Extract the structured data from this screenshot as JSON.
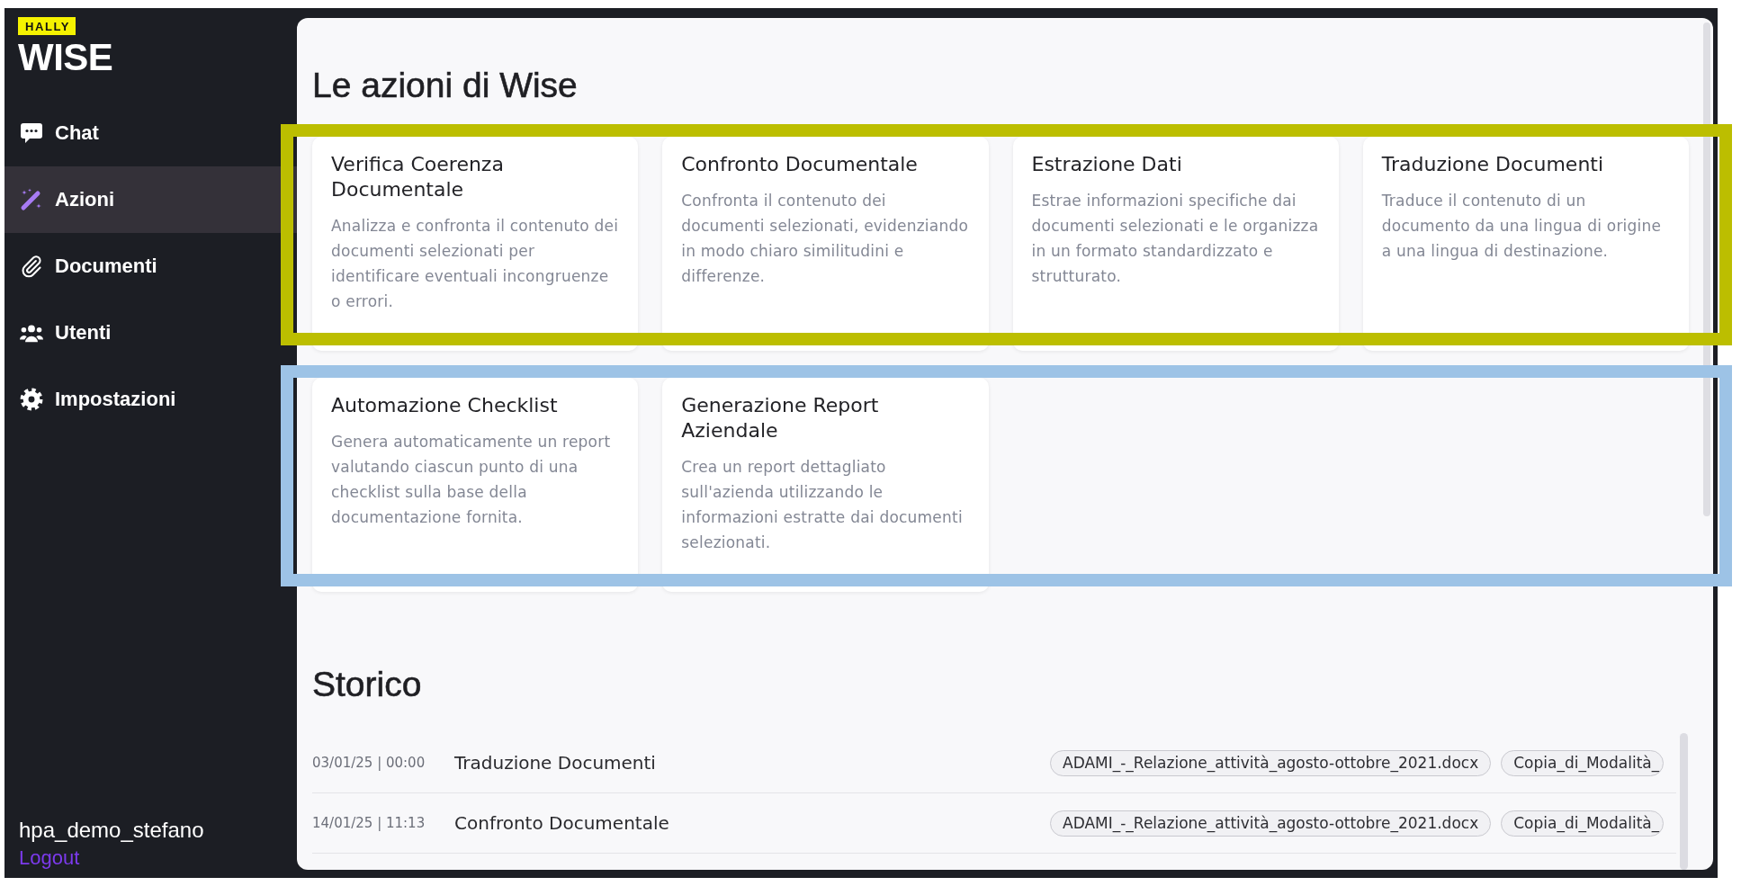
{
  "sidebar": {
    "logo": {
      "badge": "HALLY",
      "title": "WISE"
    },
    "items": [
      {
        "kind": "chat",
        "label": "Chat",
        "selected": false
      },
      {
        "kind": "actions",
        "label": "Azioni",
        "selected": true
      },
      {
        "kind": "documents",
        "label": "Documenti",
        "selected": false
      },
      {
        "kind": "users",
        "label": "Utenti",
        "selected": false
      },
      {
        "kind": "settings",
        "label": "Impostazioni",
        "selected": false
      }
    ],
    "user": {
      "name": "hpa_demo_stefano",
      "logout": "Logout"
    }
  },
  "actions": {
    "title": "Le azioni di Wise",
    "groups": [
      {
        "color": "#bcbe00",
        "cards": [
          {
            "title": "Verifica Coerenza Documentale",
            "description": "Analizza e confronta il contenuto dei documenti selezionati per identificare eventuali incongruenze o errori."
          },
          {
            "title": "Confronto Documentale",
            "description": "Confronta il contenuto dei documenti selezionati, evidenziando in modo chiaro similitudini e differenze."
          },
          {
            "title": "Estrazione Dati",
            "description": "Estrae informazioni specifiche dai documenti selezionati e le organizza in un formato standardizzato e strutturato."
          },
          {
            "title": "Traduzione Documenti",
            "description": "Traduce il contenuto di un documento da una lingua di origine a una lingua di destinazione."
          }
        ]
      },
      {
        "color": "#9dc3e6",
        "cards": [
          {
            "title": "Automazione Checklist",
            "description": "Genera automaticamente un report valutando ciascun punto di una checklist sulla base della documentazione fornita."
          },
          {
            "title": "Generazione Report Aziendale",
            "description": "Crea un report dettagliato sull'azienda utilizzando le informazioni estratte dai documenti selezionati."
          }
        ]
      }
    ]
  },
  "history": {
    "title": "Storico",
    "rows": [
      {
        "date": "03/01/25 | 00:00",
        "action": "Traduzione Documenti",
        "files": [
          "ADAMI_-_Relazione_attività_agosto-ottobre_2021.docx",
          "Copia_di_Modalità_"
        ]
      },
      {
        "date": "14/01/25 | 11:13",
        "action": "Confronto Documentale",
        "files": [
          "ADAMI_-_Relazione_attività_agosto-ottobre_2021.docx",
          "Copia_di_Modalità_"
        ]
      }
    ]
  }
}
